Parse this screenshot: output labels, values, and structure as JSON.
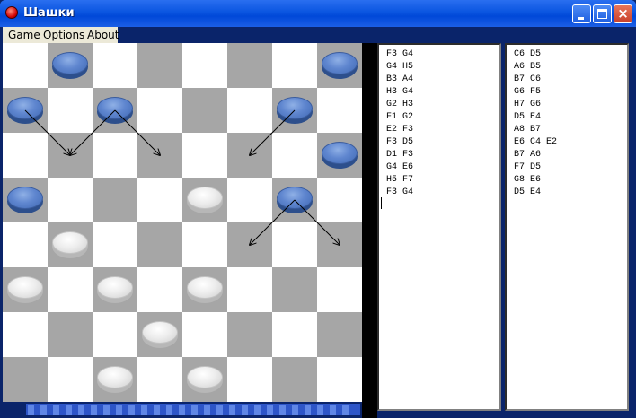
{
  "window": {
    "title": "Шашки"
  },
  "menu": [
    {
      "label": "Game"
    },
    {
      "label": "Options"
    },
    {
      "label": "About"
    }
  ],
  "board": {
    "size": 8,
    "light_color": "#ffffff",
    "dark_color": "#a6a6a6",
    "pieces": [
      {
        "color": "blue",
        "col": "B",
        "row": 8
      },
      {
        "color": "blue",
        "col": "H",
        "row": 8
      },
      {
        "color": "blue",
        "col": "A",
        "row": 7
      },
      {
        "color": "blue",
        "col": "C",
        "row": 7
      },
      {
        "color": "blue",
        "col": "G",
        "row": 7
      },
      {
        "color": "blue",
        "col": "H",
        "row": 6
      },
      {
        "color": "blue",
        "col": "A",
        "row": 5
      },
      {
        "color": "white",
        "col": "E",
        "row": 5
      },
      {
        "color": "blue",
        "col": "G",
        "row": 5
      },
      {
        "color": "white",
        "col": "B",
        "row": 4
      },
      {
        "color": "white",
        "col": "A",
        "row": 3
      },
      {
        "color": "white",
        "col": "C",
        "row": 3
      },
      {
        "color": "white",
        "col": "E",
        "row": 3
      },
      {
        "color": "white",
        "col": "D",
        "row": 2
      },
      {
        "color": "white",
        "col": "C",
        "row": 1
      },
      {
        "color": "white",
        "col": "E",
        "row": 1
      }
    ],
    "arrows": [
      {
        "from": "A7",
        "to": "B6"
      },
      {
        "from": "C7",
        "to": "B6"
      },
      {
        "from": "C7",
        "to": "D6"
      },
      {
        "from": "G7",
        "to": "F6"
      },
      {
        "from": "G5",
        "to": "F4"
      },
      {
        "from": "G5",
        "to": "H4"
      }
    ]
  },
  "status": {
    "segments": 26
  },
  "moves_left": [
    "F3 G4",
    "G4 H5",
    "B3 A4",
    "H3 G4",
    "G2 H3",
    "F1 G2",
    "E2 F3",
    "F3 D5",
    "D1 F3",
    "G4 E6",
    "H5 F7",
    "F3 G4"
  ],
  "moves_right": [
    "C6 D5",
    "A6 B5",
    "B7 C6",
    "G6 F5",
    "H7 G6",
    "D5 E4",
    "A8 B7",
    "E6 C4 E2",
    "B7 A6",
    "F7 D5",
    "G8 E6",
    "D5 E4"
  ]
}
